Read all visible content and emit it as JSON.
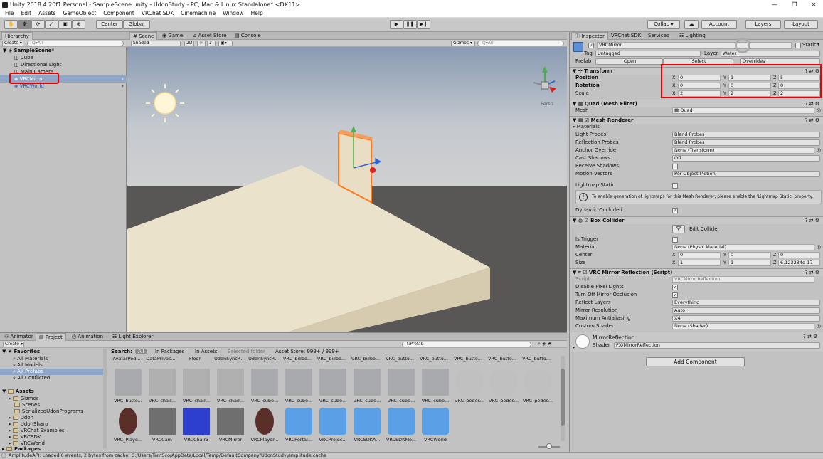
{
  "window": {
    "title": "Unity 2018.4.20f1 Personal - SampleScene.unity - UdonStudy - PC, Mac & Linux Standalone* <DX11>",
    "minimize": "—",
    "restore": "❐",
    "close": "✕"
  },
  "menu": [
    "File",
    "Edit",
    "Assets",
    "GameObject",
    "Component",
    "VRChat SDK",
    "Cinemachine",
    "Window",
    "Help"
  ],
  "toolbar": {
    "center": "Center",
    "global": "Global",
    "collab": "Collab ▾",
    "account": "Account",
    "layers": "Layers",
    "layout": "Layout"
  },
  "hierarchy": {
    "tab": "Hierarchy",
    "create": "Create ▾",
    "search_placeholder": "Q▾All",
    "scene": "SampleScene*",
    "items": [
      "Cube",
      "Directional Light",
      "Main Camera",
      "VRCMirror",
      "VRCWorld"
    ]
  },
  "scene": {
    "tabs": [
      "Scene",
      "Game",
      "Asset Store",
      "Console"
    ],
    "shading": "Shaded",
    "mode2d": "2D",
    "gizmos": "Gizmos ▾",
    "search_placeholder": "Q▾All",
    "persp": "Persp"
  },
  "inspector": {
    "tabs": [
      "Inspector",
      "VRChat SDK",
      "Services",
      "Lighting"
    ],
    "object_name": "VRCMirror",
    "static_label": "Static",
    "tag_label": "Tag",
    "tag_value": "Untagged",
    "layer_label": "Layer",
    "layer_value": "Water",
    "prefab_label": "Prefab",
    "prefab_open": "Open",
    "prefab_select": "Select",
    "prefab_overrides": "Overrides",
    "transform": {
      "title": "Transform",
      "position_label": "Position",
      "rotation_label": "Rotation",
      "scale_label": "Scale",
      "position": [
        "0",
        "1",
        "5"
      ],
      "rotation": [
        "0",
        "0",
        "0"
      ],
      "scale": [
        "2",
        "2",
        "2"
      ]
    },
    "axes": [
      "X",
      "Y",
      "Z"
    ],
    "mesh_filter": {
      "title": "Quad (Mesh Filter)",
      "mesh_label": "Mesh",
      "mesh_value": "Quad"
    },
    "mesh_renderer": {
      "title": "Mesh Renderer",
      "materials_label": "Materials",
      "rows": [
        {
          "label": "Light Probes",
          "value": "Blend Probes"
        },
        {
          "label": "Reflection Probes",
          "value": "Blend Probes"
        },
        {
          "label": "Anchor Override",
          "value": "None (Transform)"
        },
        {
          "label": "Cast Shadows",
          "value": "Off"
        },
        {
          "label": "Receive Shadows",
          "value": ""
        },
        {
          "label": "Motion Vectors",
          "value": "Per Object Motion"
        }
      ],
      "lightmap_static_label": "Lightmap Static",
      "info": "To enable generation of lightmaps for this Mesh Renderer, please enable the 'Lightmap Static' property.",
      "dynamic_occluded_label": "Dynamic Occluded"
    },
    "box_collider": {
      "title": "Box Collider",
      "edit_collider": "Edit Collider",
      "is_trigger_label": "Is Trigger",
      "material_label": "Material",
      "material_value": "None (Physic Material)",
      "center_label": "Center",
      "center": [
        "0",
        "0",
        "0"
      ],
      "size_label": "Size",
      "size": [
        "1",
        "1",
        "6.123234e-17"
      ]
    },
    "mirror": {
      "title": "VRC Mirror Reflection (Script)",
      "script_label": "Script",
      "script_value": "VRCMirrorReflection",
      "disable_pixel_lights_label": "Disable Pixel Lights",
      "turn_off_occlusion_label": "Turn Off Mirror Occlusion",
      "reflect_layers_label": "Reflect Layers",
      "reflect_layers_value": "Everything",
      "resolution_label": "Mirror Resolution",
      "resolution_value": "Auto",
      "antialiasing_label": "Maximum Antialiasing",
      "antialiasing_value": "X4",
      "custom_shader_label": "Custom Shader",
      "custom_shader_value": "None (Shader)"
    },
    "material": {
      "name": "MirrorReflection",
      "shader_label": "Shader",
      "shader_value": "FX/MirrorReflection"
    },
    "add_component": "Add Component"
  },
  "project": {
    "tabs": [
      "Animator",
      "Project",
      "Animation",
      "Light Explorer"
    ],
    "create": "Create ▾",
    "search_value": "t:Prefab",
    "search_label": "Search:",
    "filters": [
      "All",
      "In Packages",
      "In Assets",
      "Selected folder",
      "Asset Store: 999+ / 999+"
    ],
    "favorites_label": "Favorites",
    "favorites": [
      "All Materials",
      "All Models",
      "All Prefabs",
      "All Conflicted"
    ],
    "assets_label": "Assets",
    "folders": [
      "Gizmos",
      "Scenes",
      "SerializedUdonPrograms",
      "Udon",
      "UdonSharp",
      "VRChat Examples",
      "VRCSDK",
      "VRCWorld"
    ],
    "packages_label": "Packages",
    "top_labels": [
      "AvatarPed...",
      "DataPrivac...",
      "Floor",
      "UdonSyncP...",
      "UdonSyncP...",
      "VRC_billbo...",
      "VRC_billbo...",
      "VRC_billbo...",
      "VRC_butto...",
      "VRC_butto...",
      "VRC_butto...",
      "VRC_butto...",
      "VRC_butto..."
    ],
    "row1": [
      "VRC_butto...",
      "VRC_chair...",
      "VRC_chair...",
      "VRC_chair...",
      "VRC_cube...",
      "VRC_cube...",
      "VRC_cube...",
      "VRC_cube...",
      "VRC_cube...",
      "VRC_cube...",
      "VRC_pedes...",
      "VRC_pedes...",
      "VRC_pedes..."
    ],
    "row2": [
      "VRC_Playe...",
      "VRCCam",
      "VRCChair3",
      "VRCMirror",
      "VRCPlayer...",
      "VRCPortal...",
      "VRCProjec...",
      "VRCSDKA...",
      "VRCSDKMo...",
      "VRCWorld"
    ]
  },
  "status": "AmplitudeAPI: Loaded 0 events, 2 bytes from cache: C:/Users/TamSco/AppData/Local/Temp/DefaultCompany/UdonStudy\\amplitude.cache"
}
